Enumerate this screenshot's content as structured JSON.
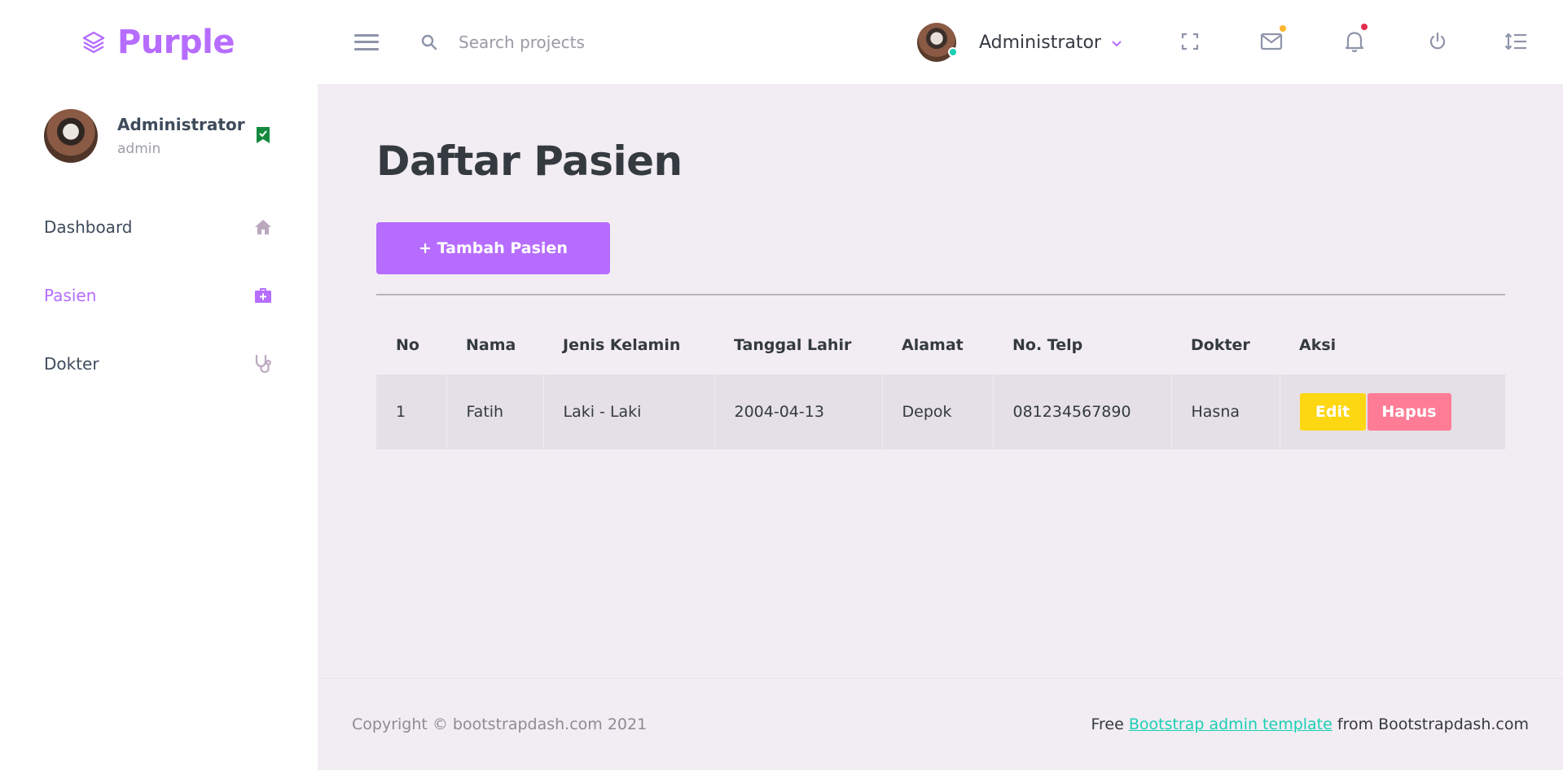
{
  "brand": {
    "name": "Purple"
  },
  "search": {
    "placeholder": "Search projects"
  },
  "navbar": {
    "user_name": "Administrator",
    "icons": [
      "fullscreen-icon",
      "mail-icon",
      "bell-icon",
      "power-icon",
      "format-line-spacing-icon"
    ]
  },
  "sidebar": {
    "profile": {
      "name": "Administrator",
      "role": "admin"
    },
    "items": [
      {
        "label": "Dashboard",
        "icon": "home-icon",
        "active": false
      },
      {
        "label": "Pasien",
        "icon": "medical-bag-icon",
        "active": true
      },
      {
        "label": "Dokter",
        "icon": "stethoscope-icon",
        "active": false
      }
    ]
  },
  "main": {
    "title": "Daftar Pasien",
    "add_button": "+ Tambah Pasien",
    "table": {
      "headers": [
        "No",
        "Nama",
        "Jenis Kelamin",
        "Tanggal Lahir",
        "Alamat",
        "No. Telp",
        "Dokter",
        "Aksi"
      ],
      "rows": [
        {
          "no": "1",
          "nama": "Fatih",
          "jenis_kelamin": "Laki - Laki",
          "tanggal_lahir": "2004-04-13",
          "alamat": "Depok",
          "no_telp": "081234567890",
          "dokter": "Hasna",
          "edit_label": "Edit",
          "delete_label": "Hapus"
        }
      ]
    }
  },
  "footer": {
    "copyright": "Copyright © bootstrapdash.com 2021",
    "free_text": "Free",
    "link_text": "Bootstrap admin template",
    "from_text": "from Bootstrapdash.com"
  },
  "colors": {
    "primary": "#b66dff",
    "success": "#1bcfb4",
    "warning": "#fed713",
    "danger": "#fe7c96",
    "background": "#f2edf3",
    "mail_badge": "#ffb52c",
    "bell_badge": "#e32d4e",
    "bookmark": "#148a3e"
  }
}
